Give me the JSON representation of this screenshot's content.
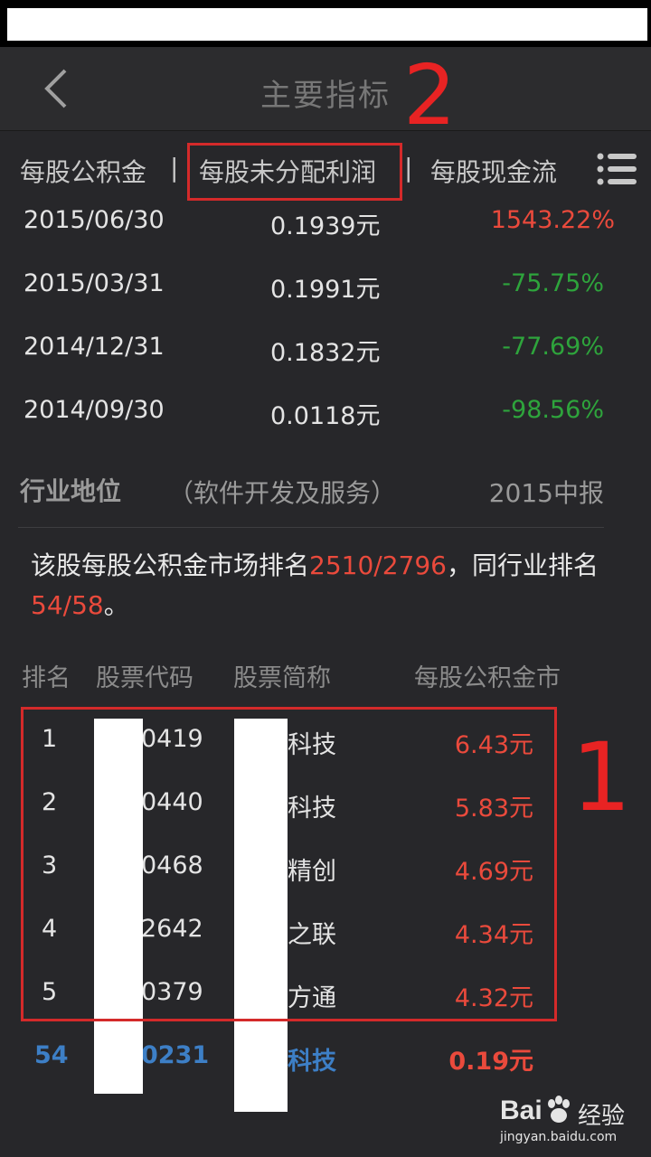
{
  "header": {
    "title": "主要指标"
  },
  "tabs": [
    {
      "label": "每股公积金"
    },
    {
      "label": "每股未分配利润"
    },
    {
      "label": "每股现金流"
    }
  ],
  "tab_separator": "|",
  "history": [
    {
      "date": "2015/06/30",
      "value": "0.1939元",
      "change": "1543.22%"
    },
    {
      "date": "2015/03/31",
      "value": "0.1991元",
      "change": "-75.75%"
    },
    {
      "date": "2014/12/31",
      "value": "0.1832元",
      "change": "-77.69%"
    },
    {
      "date": "2014/09/30",
      "value": "0.0118元",
      "change": "-98.56%"
    }
  ],
  "industry": {
    "heading": "行业地位",
    "sector": "（软件开发及服务）",
    "period": "2015中报",
    "desc_prefix": "该股每股公积金市场排名",
    "market_rank": "2510/2796",
    "desc_middle": "，同行业排名",
    "industry_rank": "54/58",
    "desc_suffix": "。"
  },
  "table": {
    "columns": [
      "排名",
      "股票代码",
      "股票简称",
      "每股公积金市"
    ],
    "rows": [
      {
        "rank": "1",
        "code": "0419",
        "name": "科技",
        "value": "6.43元"
      },
      {
        "rank": "2",
        "code": "0440",
        "name": "科技",
        "value": "5.83元"
      },
      {
        "rank": "3",
        "code": "0468",
        "name": "精创",
        "value": "4.69元"
      },
      {
        "rank": "4",
        "code": "2642",
        "name": "之联",
        "value": "4.34元"
      },
      {
        "rank": "5",
        "code": "0379",
        "name": "方通",
        "value": "4.32元"
      }
    ],
    "self_row": {
      "rank": "54",
      "code": "0231",
      "name": "科技",
      "value": "0.19元"
    }
  },
  "annotations": {
    "label_1": "1",
    "label_2": "2"
  },
  "watermark": {
    "brand": "Bai",
    "brand2": "经验",
    "url": "jingyan.baidu.com"
  },
  "colors": {
    "positive": "#ea4a3c",
    "negative": "#2ea43c",
    "highlight": "#3d7fc6",
    "annotation": "#e82323"
  }
}
